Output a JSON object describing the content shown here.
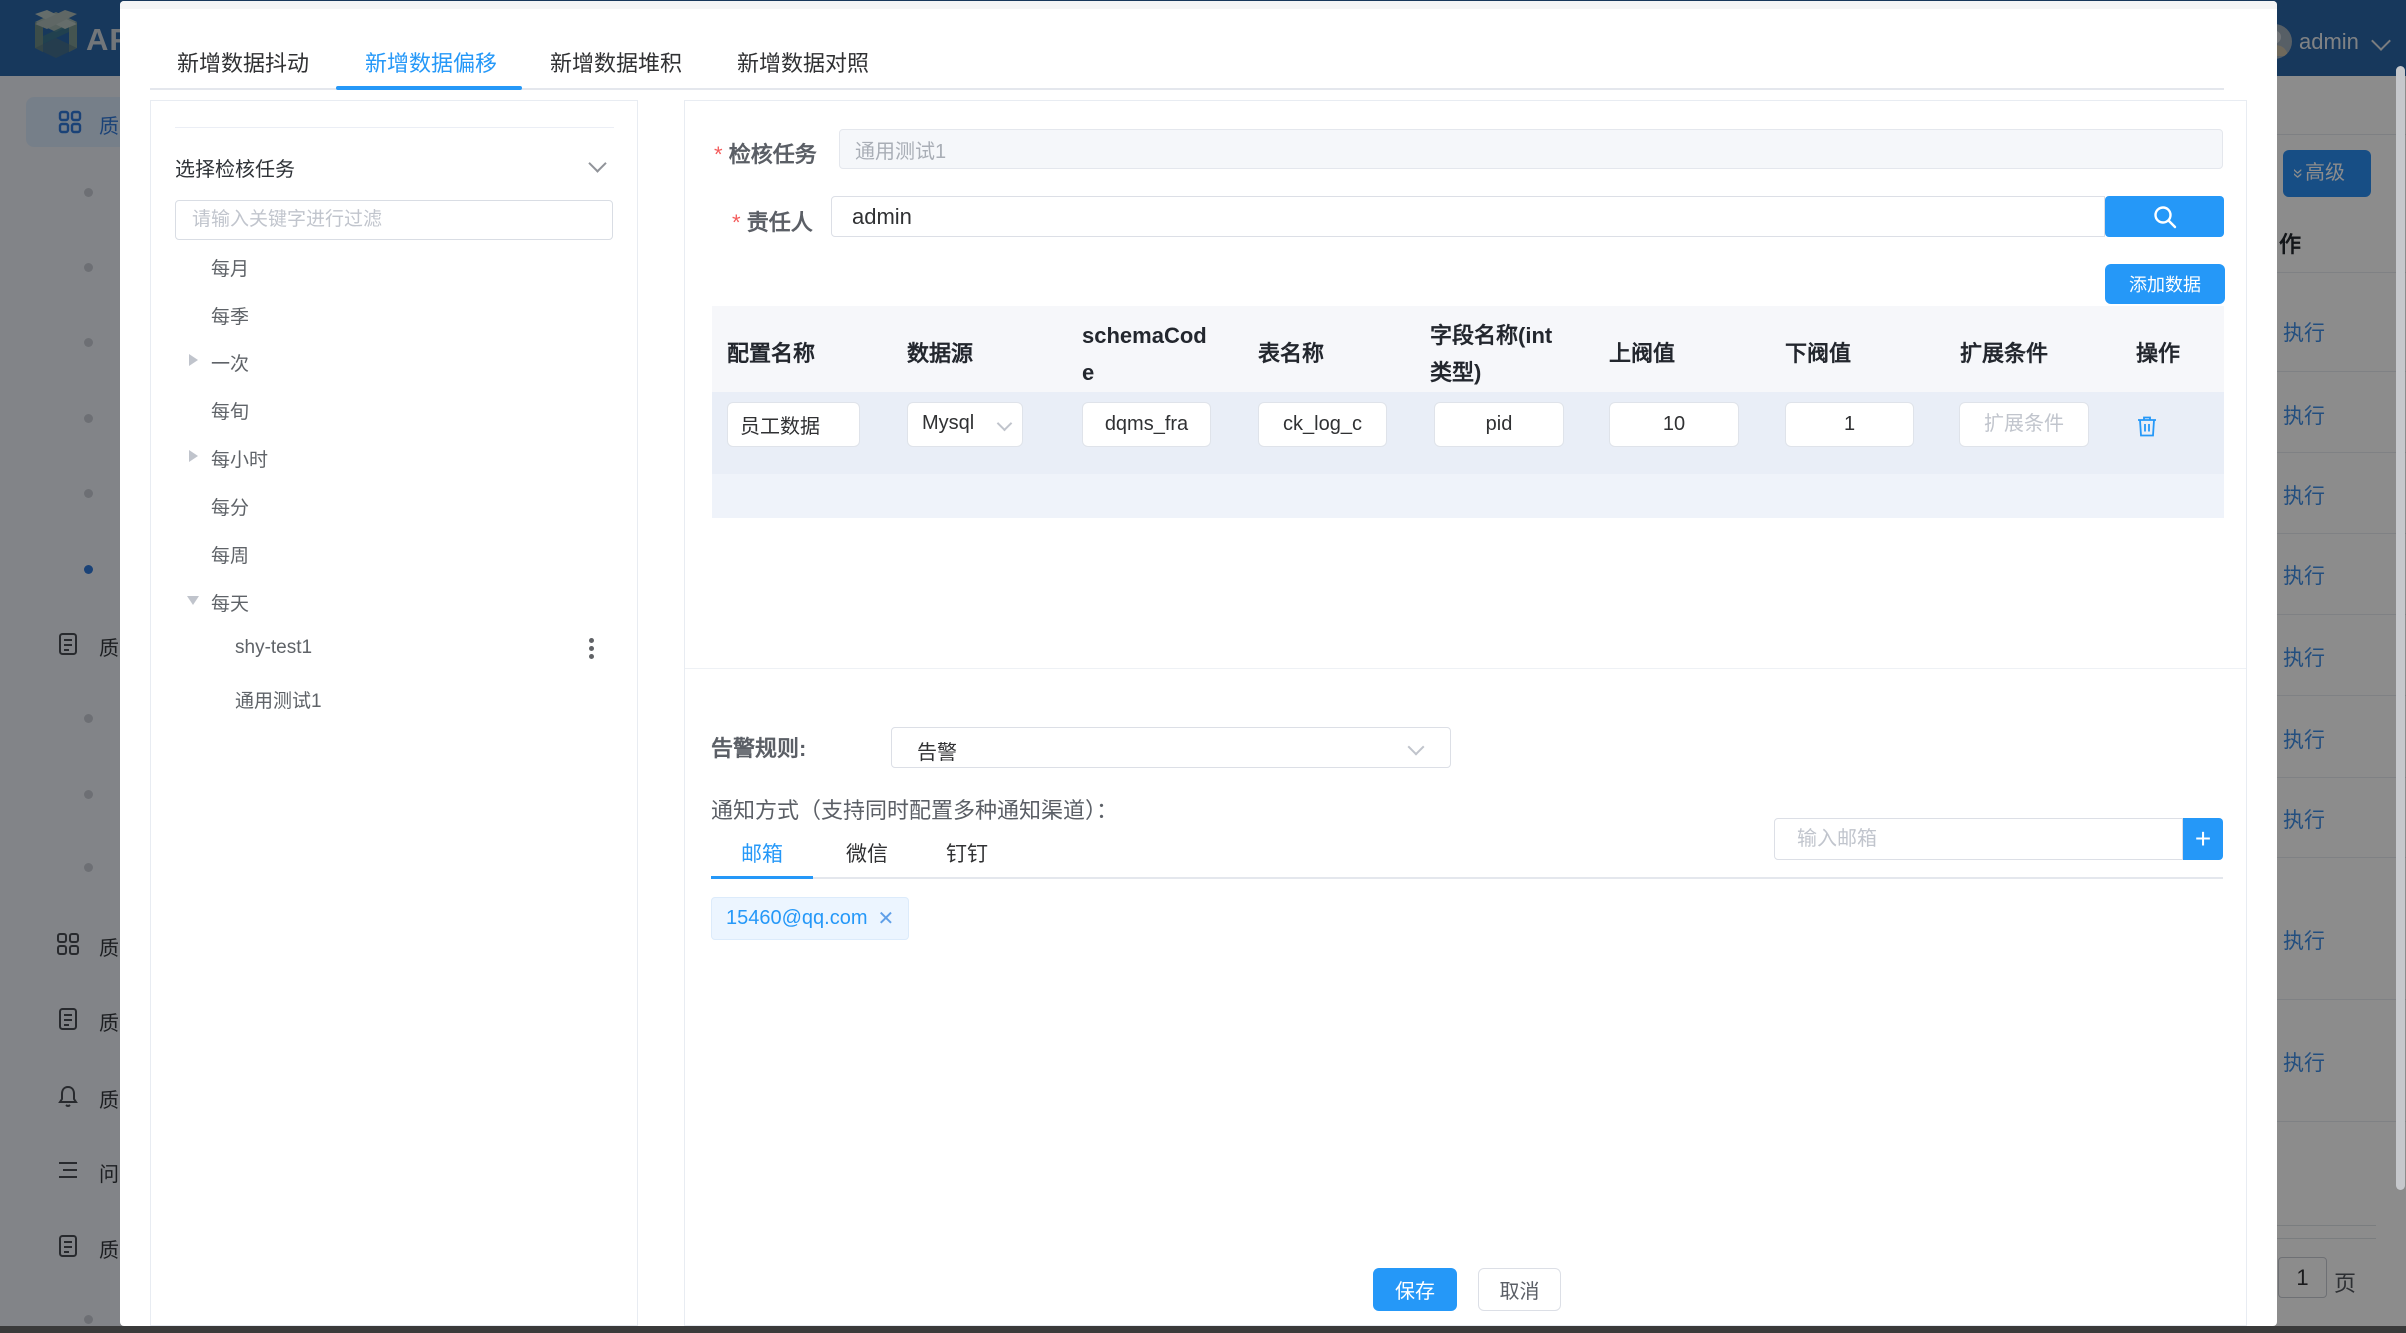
{
  "colors": {
    "primary": "#2598f8",
    "header_bg": "#2a66a8",
    "overlay": "rgba(0,0,0,0.45)",
    "table_header_bg": "#f6f7fa",
    "table_row_bg": "#e9eef7",
    "tag_bg": "#ecf5ff",
    "danger_star": "#f45c5c"
  },
  "header": {
    "logo_text": "AP",
    "user_name": "admin"
  },
  "sidebar": {
    "active_item": {
      "label": "质",
      "icon": "grid-icon"
    },
    "items": [
      {
        "label": "质",
        "icon": "document-icon"
      },
      {
        "label": "质",
        "icon": "grid-icon"
      },
      {
        "label": "质",
        "icon": "document-icon"
      },
      {
        "label": "质",
        "icon": "bell-icon"
      },
      {
        "label": "问",
        "icon": "list-icon"
      },
      {
        "label": "质",
        "icon": "document-icon"
      }
    ]
  },
  "background_page": {
    "advanced_button": {
      "label": "高级",
      "icon": "double-chevron-down-icon"
    },
    "table_column_header": "作",
    "action_link_label": "执行",
    "action_rows_count": 9,
    "pagination": {
      "current_page": "1",
      "unit_label": "页"
    }
  },
  "dialog": {
    "tabs": [
      {
        "label": "新增数据抖动",
        "active": false
      },
      {
        "label": "新增数据偏移",
        "active": true
      },
      {
        "label": "新增数据堆积",
        "active": false
      },
      {
        "label": "新增数据对照",
        "active": false
      }
    ],
    "tree_panel": {
      "collapse_title": "选择检核任务",
      "filter_placeholder": "请输入关键字进行过滤",
      "items": [
        {
          "label": "每月",
          "level": 1,
          "caret": "none"
        },
        {
          "label": "每季",
          "level": 1,
          "caret": "none"
        },
        {
          "label": "一次",
          "level": 1,
          "caret": "right"
        },
        {
          "label": "每旬",
          "level": 1,
          "caret": "none"
        },
        {
          "label": "每小时",
          "level": 1,
          "caret": "right"
        },
        {
          "label": "每分",
          "level": 1,
          "caret": "none"
        },
        {
          "label": "每周",
          "level": 1,
          "caret": "none"
        },
        {
          "label": "每天",
          "level": 1,
          "caret": "down"
        },
        {
          "label": "shy-test1",
          "level": 2,
          "caret": "none",
          "kebab": true
        },
        {
          "label": "通用测试1",
          "level": 2,
          "caret": "none"
        }
      ]
    },
    "form": {
      "task_label": "检核任务",
      "task_value": "通用测试1",
      "owner_label": "责任人",
      "owner_value": "admin",
      "add_data_button": "添加数据",
      "table": {
        "columns": [
          "配置名称",
          "数据源",
          "schemaCode",
          "表名称",
          "字段名称(int类型)",
          "上阀值",
          "下阀值",
          "扩展条件",
          "操作"
        ],
        "row": {
          "config_name": "员工数据",
          "datasource": "Mysql",
          "schema_code": "dqms_fra",
          "table_name": "ck_log_c",
          "field_name": "pid",
          "upper_threshold": "10",
          "lower_threshold": "1",
          "ext_condition_placeholder": "扩展条件"
        }
      },
      "alarm_rule_label": "告警规则:",
      "alarm_rule_value": "告警",
      "notice_label": "通知方式（支持同时配置多种通知渠道）：",
      "channel_tabs": [
        {
          "label": "邮箱",
          "active": true
        },
        {
          "label": "微信",
          "active": false
        },
        {
          "label": "钉钉",
          "active": false
        }
      ],
      "email_placeholder": "输入邮箱",
      "email_tag": "15460@qq.com",
      "save_button": "保存",
      "cancel_button": "取消"
    }
  }
}
